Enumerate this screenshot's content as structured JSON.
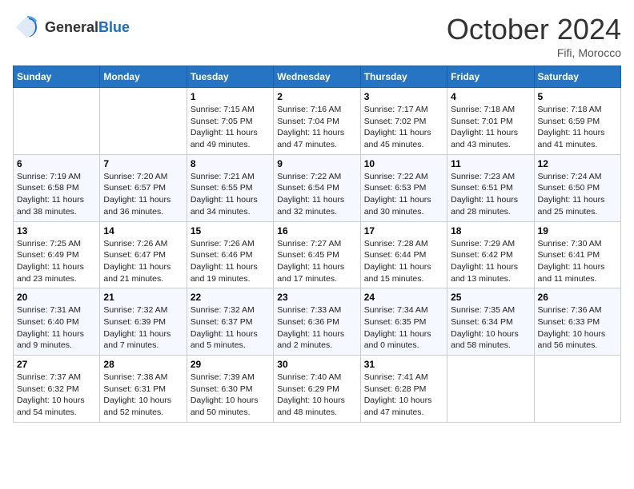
{
  "header": {
    "logo_general": "General",
    "logo_blue": "Blue",
    "month": "October 2024",
    "location": "Fifi, Morocco"
  },
  "days_of_week": [
    "Sunday",
    "Monday",
    "Tuesday",
    "Wednesday",
    "Thursday",
    "Friday",
    "Saturday"
  ],
  "weeks": [
    [
      {
        "day": "",
        "text": ""
      },
      {
        "day": "",
        "text": ""
      },
      {
        "day": "1",
        "text": "Sunrise: 7:15 AM\nSunset: 7:05 PM\nDaylight: 11 hours and 49 minutes."
      },
      {
        "day": "2",
        "text": "Sunrise: 7:16 AM\nSunset: 7:04 PM\nDaylight: 11 hours and 47 minutes."
      },
      {
        "day": "3",
        "text": "Sunrise: 7:17 AM\nSunset: 7:02 PM\nDaylight: 11 hours and 45 minutes."
      },
      {
        "day": "4",
        "text": "Sunrise: 7:18 AM\nSunset: 7:01 PM\nDaylight: 11 hours and 43 minutes."
      },
      {
        "day": "5",
        "text": "Sunrise: 7:18 AM\nSunset: 6:59 PM\nDaylight: 11 hours and 41 minutes."
      }
    ],
    [
      {
        "day": "6",
        "text": "Sunrise: 7:19 AM\nSunset: 6:58 PM\nDaylight: 11 hours and 38 minutes."
      },
      {
        "day": "7",
        "text": "Sunrise: 7:20 AM\nSunset: 6:57 PM\nDaylight: 11 hours and 36 minutes."
      },
      {
        "day": "8",
        "text": "Sunrise: 7:21 AM\nSunset: 6:55 PM\nDaylight: 11 hours and 34 minutes."
      },
      {
        "day": "9",
        "text": "Sunrise: 7:22 AM\nSunset: 6:54 PM\nDaylight: 11 hours and 32 minutes."
      },
      {
        "day": "10",
        "text": "Sunrise: 7:22 AM\nSunset: 6:53 PM\nDaylight: 11 hours and 30 minutes."
      },
      {
        "day": "11",
        "text": "Sunrise: 7:23 AM\nSunset: 6:51 PM\nDaylight: 11 hours and 28 minutes."
      },
      {
        "day": "12",
        "text": "Sunrise: 7:24 AM\nSunset: 6:50 PM\nDaylight: 11 hours and 25 minutes."
      }
    ],
    [
      {
        "day": "13",
        "text": "Sunrise: 7:25 AM\nSunset: 6:49 PM\nDaylight: 11 hours and 23 minutes."
      },
      {
        "day": "14",
        "text": "Sunrise: 7:26 AM\nSunset: 6:47 PM\nDaylight: 11 hours and 21 minutes."
      },
      {
        "day": "15",
        "text": "Sunrise: 7:26 AM\nSunset: 6:46 PM\nDaylight: 11 hours and 19 minutes."
      },
      {
        "day": "16",
        "text": "Sunrise: 7:27 AM\nSunset: 6:45 PM\nDaylight: 11 hours and 17 minutes."
      },
      {
        "day": "17",
        "text": "Sunrise: 7:28 AM\nSunset: 6:44 PM\nDaylight: 11 hours and 15 minutes."
      },
      {
        "day": "18",
        "text": "Sunrise: 7:29 AM\nSunset: 6:42 PM\nDaylight: 11 hours and 13 minutes."
      },
      {
        "day": "19",
        "text": "Sunrise: 7:30 AM\nSunset: 6:41 PM\nDaylight: 11 hours and 11 minutes."
      }
    ],
    [
      {
        "day": "20",
        "text": "Sunrise: 7:31 AM\nSunset: 6:40 PM\nDaylight: 11 hours and 9 minutes."
      },
      {
        "day": "21",
        "text": "Sunrise: 7:32 AM\nSunset: 6:39 PM\nDaylight: 11 hours and 7 minutes."
      },
      {
        "day": "22",
        "text": "Sunrise: 7:32 AM\nSunset: 6:37 PM\nDaylight: 11 hours and 5 minutes."
      },
      {
        "day": "23",
        "text": "Sunrise: 7:33 AM\nSunset: 6:36 PM\nDaylight: 11 hours and 2 minutes."
      },
      {
        "day": "24",
        "text": "Sunrise: 7:34 AM\nSunset: 6:35 PM\nDaylight: 11 hours and 0 minutes."
      },
      {
        "day": "25",
        "text": "Sunrise: 7:35 AM\nSunset: 6:34 PM\nDaylight: 10 hours and 58 minutes."
      },
      {
        "day": "26",
        "text": "Sunrise: 7:36 AM\nSunset: 6:33 PM\nDaylight: 10 hours and 56 minutes."
      }
    ],
    [
      {
        "day": "27",
        "text": "Sunrise: 7:37 AM\nSunset: 6:32 PM\nDaylight: 10 hours and 54 minutes."
      },
      {
        "day": "28",
        "text": "Sunrise: 7:38 AM\nSunset: 6:31 PM\nDaylight: 10 hours and 52 minutes."
      },
      {
        "day": "29",
        "text": "Sunrise: 7:39 AM\nSunset: 6:30 PM\nDaylight: 10 hours and 50 minutes."
      },
      {
        "day": "30",
        "text": "Sunrise: 7:40 AM\nSunset: 6:29 PM\nDaylight: 10 hours and 48 minutes."
      },
      {
        "day": "31",
        "text": "Sunrise: 7:41 AM\nSunset: 6:28 PM\nDaylight: 10 hours and 47 minutes."
      },
      {
        "day": "",
        "text": ""
      },
      {
        "day": "",
        "text": ""
      }
    ]
  ]
}
